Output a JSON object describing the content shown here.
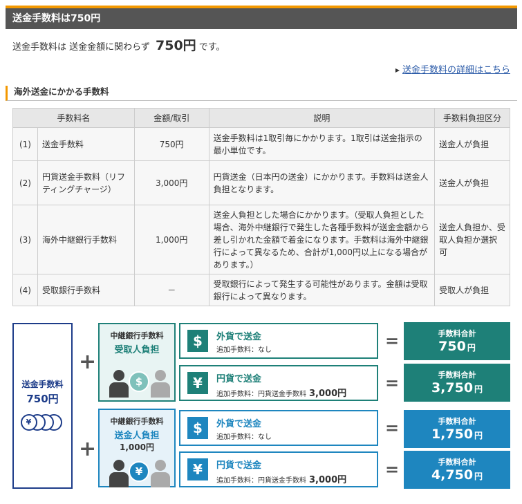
{
  "header": {
    "title": "送金手数料は750円"
  },
  "intro": {
    "prefix": "送金手数料は 送金金額に関わらず",
    "amount": "750円",
    "suffix": "です。"
  },
  "detail_link": "送金手数料の詳細はこちら",
  "section": {
    "title": "海外送金にかかる手数料"
  },
  "table": {
    "headers": [
      "手数料名",
      "金額/取引",
      "説明",
      "手数料負担区分"
    ],
    "rows": [
      {
        "no": "(1)",
        "name": "送金手数料",
        "amount": "750円",
        "desc": "送金手数料は1取引毎にかかります。1取引は送金指示の最小単位です。",
        "payer": "送金人が負担"
      },
      {
        "no": "(2)",
        "name": "円貨送金手数料（リフティングチャージ）",
        "amount": "3,000円",
        "desc": "円貨送金（日本円の送金）にかかります。手数料は送金人負担となります。",
        "payer": "送金人が負担"
      },
      {
        "no": "(3)",
        "name": "海外中継銀行手数料",
        "amount": "1,000円",
        "desc": "送金人負担とした場合にかかります。（受取人負担とした場合、海外中継銀行で発生した各種手数料が送金金額から差し引かれた金額で着金になります。手数料は海外中継銀行によって異なるため、合計が1,000円以上になる場合があります。）",
        "payer": "送金人負担か、受取人負担か選択可"
      },
      {
        "no": "(4)",
        "name": "受取銀行手数料",
        "amount": "－",
        "desc": "受取銀行によって発生する可能性があります。金額は受取銀行によって異なります。",
        "payer": "受取人が負担"
      }
    ]
  },
  "diagram": {
    "fee": {
      "label": "送金手数料",
      "value": "750円"
    },
    "plus": "+",
    "equals": "=",
    "coin_symbol": "¥",
    "panels": [
      {
        "line1": "中継銀行手数料",
        "line2": "受取人負担",
        "line3": "",
        "badge": "$"
      },
      {
        "line1": "中継銀行手数料",
        "line2": "送金人負担",
        "line3": "1,000円",
        "badge": "¥"
      }
    ],
    "rows": [
      {
        "icon": "$",
        "title": "外貨で送金",
        "sub": "追加手数料：なし",
        "sub_amt": ""
      },
      {
        "icon": "¥",
        "title": "円貨で送金",
        "sub": "追加手数料：円貨送金手数料",
        "sub_amt": "3,000円"
      },
      {
        "icon": "$",
        "title": "外貨で送金",
        "sub": "追加手数料：なし",
        "sub_amt": ""
      },
      {
        "icon": "¥",
        "title": "円貨で送金",
        "sub": "追加手数料：円貨送金手数料",
        "sub_amt": "3,000円"
      }
    ],
    "totals": [
      {
        "label": "手数料合計",
        "value": "750",
        "unit": "円"
      },
      {
        "label": "手数料合計",
        "value": "3,750",
        "unit": "円"
      },
      {
        "label": "手数料合計",
        "value": "1,750",
        "unit": "円"
      },
      {
        "label": "手数料合計",
        "value": "4,750",
        "unit": "円"
      }
    ]
  },
  "colors": {
    "accent": "#f39800",
    "teal": "#1e8078",
    "blue": "#1e86bf",
    "navy": "#1d3c89"
  }
}
